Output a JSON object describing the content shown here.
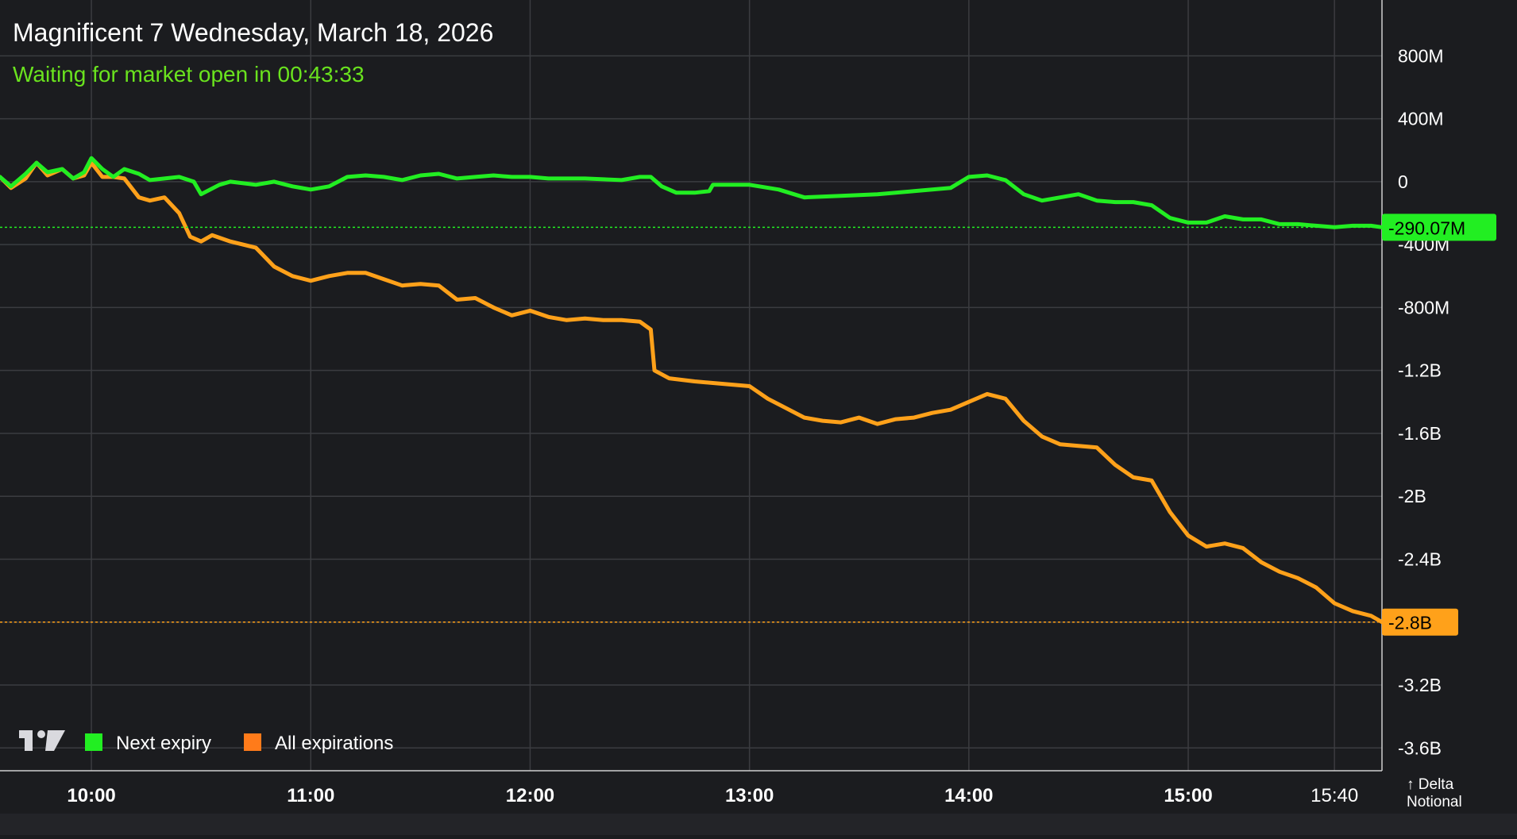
{
  "header": {
    "title": "Magnificent 7 Wednesday, March 18, 2026",
    "status": "Waiting for market open in 00:43:33"
  },
  "axis": {
    "y_caption_line1": "↑ Delta",
    "y_caption_line2": "Notional"
  },
  "legend": {
    "items": [
      {
        "label": "Next expiry",
        "color": "#22ee22",
        "icon": "green-square"
      },
      {
        "label": "All expirations",
        "color": "#ff7b1a",
        "icon": "orange-square"
      }
    ]
  },
  "logo": {
    "icon": "tradingview-logo"
  },
  "colors": {
    "background": "#1b1c1f",
    "grid": "#3b3c40",
    "text": "#ffffff",
    "status": "#6ae31e",
    "next_expiry": "#22ee22",
    "all_expirations": "#ffa11a"
  },
  "chart_data": {
    "type": "line",
    "x_unit": "time of day (ET)",
    "xlim": [
      "09:35",
      "15:53"
    ],
    "x_ticks": [
      "10:00",
      "11:00",
      "12:00",
      "13:00",
      "14:00",
      "15:00",
      "15:40"
    ],
    "y_ticks": [
      {
        "value": 800,
        "label": "800M"
      },
      {
        "value": 400,
        "label": "400M"
      },
      {
        "value": 0,
        "label": "0"
      },
      {
        "value": -400,
        "label": "-400M"
      },
      {
        "value": -800,
        "label": "-800M"
      },
      {
        "value": -1200,
        "label": "-1.2B"
      },
      {
        "value": -1600,
        "label": "-1.6B"
      },
      {
        "value": -2000,
        "label": "-2B"
      },
      {
        "value": -2400,
        "label": "-2.4B"
      },
      {
        "value": -2800,
        "label": "-2.8B"
      },
      {
        "value": -3200,
        "label": "-3.2B"
      },
      {
        "value": -3600,
        "label": "-3.6B"
      }
    ],
    "y_unit": "millions USD",
    "ylim": [
      -3745,
      1155
    ],
    "grid": true,
    "legend_position": "bottom-left",
    "series": [
      {
        "name": "Next expiry",
        "color": "#22ee22",
        "last_value": -290.07,
        "last_label": "-290.07M",
        "points": [
          [
            "09:35",
            30
          ],
          [
            "09:38",
            -30
          ],
          [
            "09:42",
            50
          ],
          [
            "09:45",
            120
          ],
          [
            "09:48",
            60
          ],
          [
            "09:52",
            80
          ],
          [
            "09:55",
            20
          ],
          [
            "09:58",
            60
          ],
          [
            "10:00",
            150
          ],
          [
            "10:03",
            80
          ],
          [
            "10:06",
            30
          ],
          [
            "10:09",
            80
          ],
          [
            "10:13",
            50
          ],
          [
            "10:16",
            10
          ],
          [
            "10:20",
            20
          ],
          [
            "10:24",
            30
          ],
          [
            "10:28",
            0
          ],
          [
            "10:30",
            -80
          ],
          [
            "10:35",
            -20
          ],
          [
            "10:38",
            0
          ],
          [
            "10:45",
            -20
          ],
          [
            "10:50",
            0
          ],
          [
            "10:55",
            -30
          ],
          [
            "11:00",
            -50
          ],
          [
            "11:05",
            -30
          ],
          [
            "11:10",
            30
          ],
          [
            "11:15",
            40
          ],
          [
            "11:20",
            30
          ],
          [
            "11:25",
            10
          ],
          [
            "11:30",
            40
          ],
          [
            "11:35",
            50
          ],
          [
            "11:40",
            20
          ],
          [
            "11:45",
            30
          ],
          [
            "11:50",
            40
          ],
          [
            "11:55",
            30
          ],
          [
            "12:00",
            30
          ],
          [
            "12:05",
            20
          ],
          [
            "12:15",
            20
          ],
          [
            "12:25",
            10
          ],
          [
            "12:30",
            30
          ],
          [
            "12:33",
            30
          ],
          [
            "12:36",
            -30
          ],
          [
            "12:40",
            -70
          ],
          [
            "12:45",
            -70
          ],
          [
            "12:49",
            -60
          ],
          [
            "12:50",
            -20
          ],
          [
            "13:00",
            -20
          ],
          [
            "13:08",
            -50
          ],
          [
            "13:15",
            -100
          ],
          [
            "13:25",
            -90
          ],
          [
            "13:35",
            -80
          ],
          [
            "13:45",
            -60
          ],
          [
            "13:55",
            -40
          ],
          [
            "14:00",
            30
          ],
          [
            "14:05",
            40
          ],
          [
            "14:10",
            10
          ],
          [
            "14:15",
            -80
          ],
          [
            "14:20",
            -120
          ],
          [
            "14:25",
            -100
          ],
          [
            "14:30",
            -80
          ],
          [
            "14:35",
            -120
          ],
          [
            "14:40",
            -130
          ],
          [
            "14:45",
            -130
          ],
          [
            "14:50",
            -150
          ],
          [
            "14:55",
            -230
          ],
          [
            "15:00",
            -260
          ],
          [
            "15:05",
            -260
          ],
          [
            "15:10",
            -220
          ],
          [
            "15:15",
            -240
          ],
          [
            "15:20",
            -240
          ],
          [
            "15:25",
            -270
          ],
          [
            "15:30",
            -270
          ],
          [
            "15:35",
            -280
          ],
          [
            "15:40",
            -290
          ],
          [
            "15:45",
            -280
          ],
          [
            "15:50",
            -280
          ],
          [
            "15:53",
            -290
          ]
        ]
      },
      {
        "name": "All expirations",
        "color": "#ffa11a",
        "last_value": -2800,
        "last_label": "-2.8B",
        "points": [
          [
            "09:35",
            30
          ],
          [
            "09:38",
            -40
          ],
          [
            "09:42",
            20
          ],
          [
            "09:45",
            120
          ],
          [
            "09:48",
            40
          ],
          [
            "09:52",
            80
          ],
          [
            "09:55",
            20
          ],
          [
            "09:58",
            40
          ],
          [
            "10:00",
            120
          ],
          [
            "10:03",
            30
          ],
          [
            "10:06",
            30
          ],
          [
            "10:09",
            20
          ],
          [
            "10:13",
            -100
          ],
          [
            "10:16",
            -120
          ],
          [
            "10:20",
            -100
          ],
          [
            "10:24",
            -200
          ],
          [
            "10:27",
            -350
          ],
          [
            "10:30",
            -380
          ],
          [
            "10:33",
            -340
          ],
          [
            "10:38",
            -380
          ],
          [
            "10:45",
            -420
          ],
          [
            "10:50",
            -540
          ],
          [
            "10:55",
            -600
          ],
          [
            "11:00",
            -630
          ],
          [
            "11:05",
            -600
          ],
          [
            "11:10",
            -580
          ],
          [
            "11:15",
            -580
          ],
          [
            "11:20",
            -620
          ],
          [
            "11:25",
            -660
          ],
          [
            "11:30",
            -650
          ],
          [
            "11:35",
            -660
          ],
          [
            "11:40",
            -750
          ],
          [
            "11:45",
            -740
          ],
          [
            "11:50",
            -800
          ],
          [
            "11:55",
            -850
          ],
          [
            "12:00",
            -820
          ],
          [
            "12:05",
            -860
          ],
          [
            "12:10",
            -880
          ],
          [
            "12:15",
            -870
          ],
          [
            "12:20",
            -880
          ],
          [
            "12:25",
            -880
          ],
          [
            "12:30",
            -890
          ],
          [
            "12:33",
            -940
          ],
          [
            "12:34",
            -1200
          ],
          [
            "12:38",
            -1250
          ],
          [
            "12:45",
            -1270
          ],
          [
            "12:50",
            -1280
          ],
          [
            "13:00",
            -1300
          ],
          [
            "13:05",
            -1380
          ],
          [
            "13:10",
            -1440
          ],
          [
            "13:15",
            -1500
          ],
          [
            "13:20",
            -1520
          ],
          [
            "13:25",
            -1530
          ],
          [
            "13:30",
            -1500
          ],
          [
            "13:35",
            -1540
          ],
          [
            "13:40",
            -1510
          ],
          [
            "13:45",
            -1500
          ],
          [
            "13:50",
            -1470
          ],
          [
            "13:55",
            -1450
          ],
          [
            "14:00",
            -1400
          ],
          [
            "14:05",
            -1350
          ],
          [
            "14:10",
            -1380
          ],
          [
            "14:15",
            -1520
          ],
          [
            "14:20",
            -1620
          ],
          [
            "14:25",
            -1670
          ],
          [
            "14:30",
            -1680
          ],
          [
            "14:35",
            -1690
          ],
          [
            "14:40",
            -1800
          ],
          [
            "14:45",
            -1880
          ],
          [
            "14:50",
            -1900
          ],
          [
            "14:55",
            -2100
          ],
          [
            "15:00",
            -2250
          ],
          [
            "15:05",
            -2320
          ],
          [
            "15:10",
            -2300
          ],
          [
            "15:15",
            -2330
          ],
          [
            "15:20",
            -2420
          ],
          [
            "15:25",
            -2480
          ],
          [
            "15:30",
            -2520
          ],
          [
            "15:35",
            -2580
          ],
          [
            "15:40",
            -2680
          ],
          [
            "15:45",
            -2730
          ],
          [
            "15:50",
            -2760
          ],
          [
            "15:53",
            -2800
          ]
        ]
      }
    ]
  }
}
